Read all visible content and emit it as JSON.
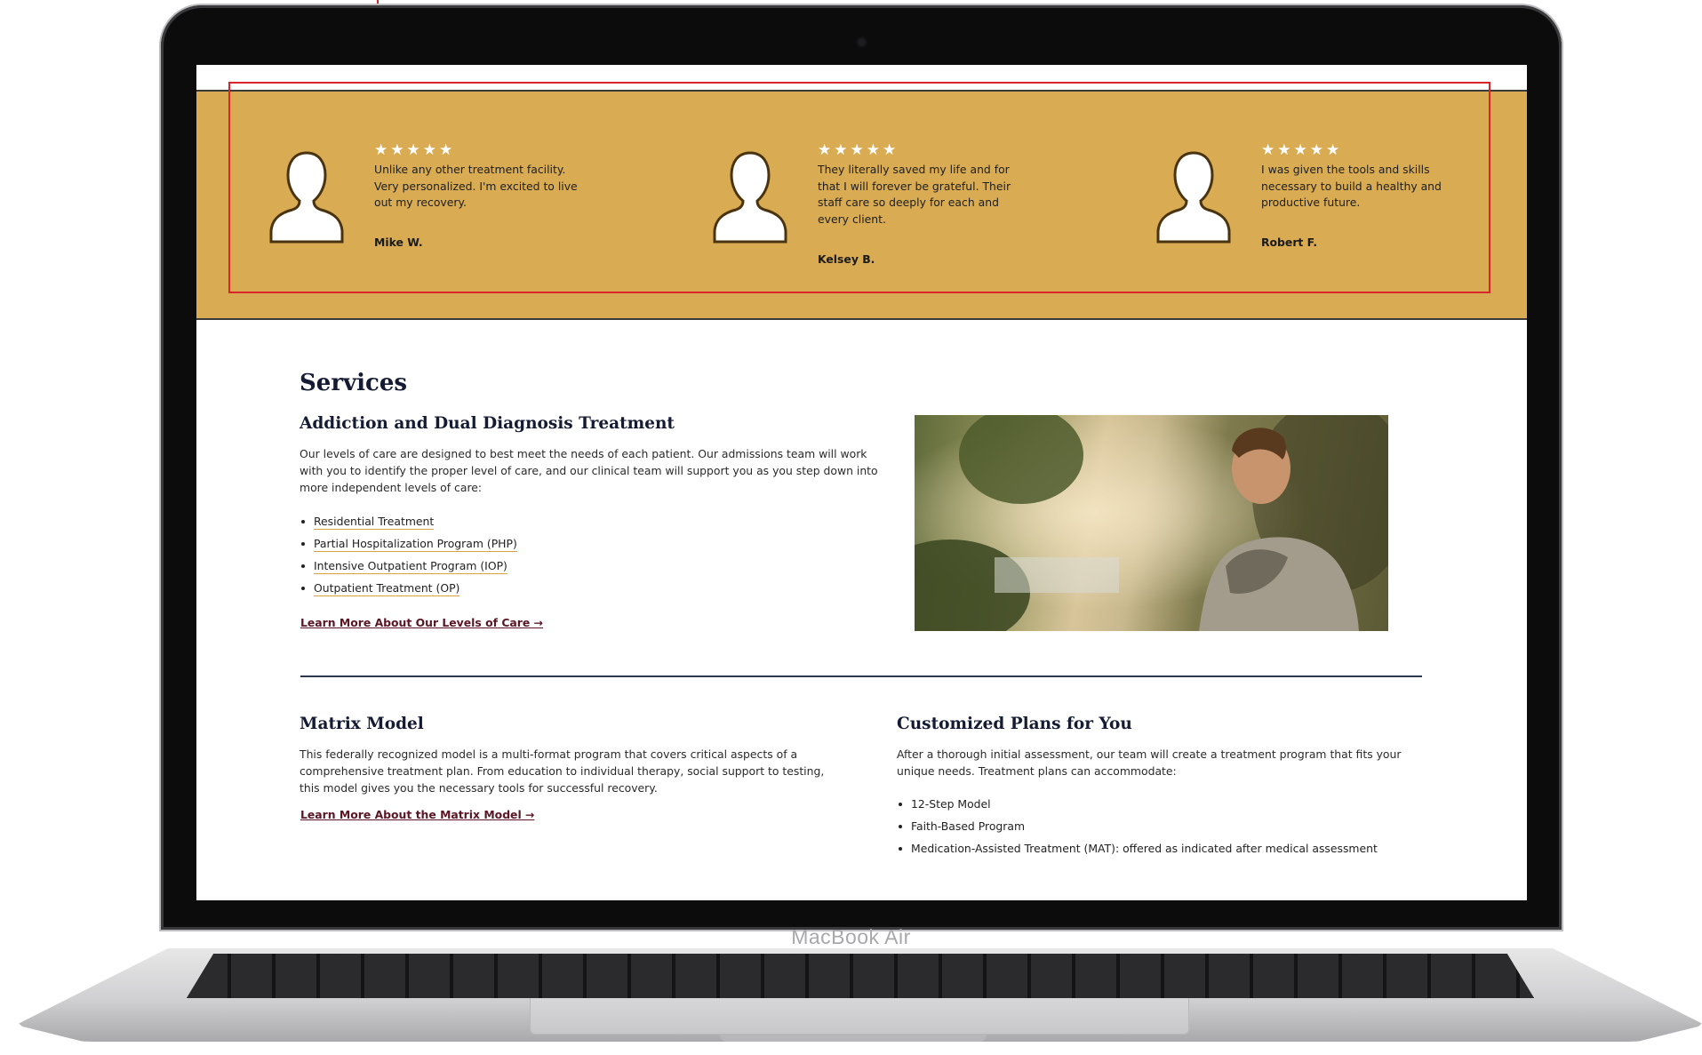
{
  "device": {
    "label": "MacBook Air"
  },
  "colors": {
    "testimonial_bg": "#d9ab52",
    "heading": "#141b33",
    "cta": "#5c1524",
    "link_underline": "#d9a33f",
    "annotation": "#d9262b"
  },
  "testimonials": [
    {
      "stars": "★★★★★",
      "rating": 5,
      "quote": "Unlike any other treatment facility. Very personalized. I'm excited to live out my recovery.",
      "author": "Mike W.",
      "avatar_icon": "user-silhouette-icon"
    },
    {
      "stars": "★★★★★",
      "rating": 5,
      "quote": "They literally saved my life and for that I will forever be grateful. Their staff care so deeply for each and every client.",
      "author": "Kelsey B.",
      "avatar_icon": "user-silhouette-icon"
    },
    {
      "stars": "★★★★★",
      "rating": 5,
      "quote": "I was given the tools and skills necessary to build a healthy and productive future.",
      "author": "Robert F.",
      "avatar_icon": "user-silhouette-icon"
    }
  ],
  "services": {
    "title": "Services",
    "addiction": {
      "heading": "Addiction and Dual Diagnosis Treatment",
      "body": "Our levels of care are designed to best meet the needs of each patient. Our admissions team will work with you to identify the proper level of care, and our clinical team will support you as you step down into more independent levels of care:",
      "items": [
        "Residential Treatment",
        "Partial Hospitalization Program (PHP)",
        "Intensive Outpatient Program (IOP)",
        "Outpatient Treatment (OP)"
      ],
      "cta": "Learn More About Our Levels of Care →"
    },
    "matrix": {
      "heading": "Matrix Model",
      "body": "This federally recognized model is a multi-format program that covers critical aspects of a comprehensive treatment plan. From education to individual therapy, social support to testing, this model gives you the necessary tools for successful recovery.",
      "cta": "Learn More About the Matrix Model →"
    },
    "custom": {
      "heading": "Customized Plans for You",
      "body": "After a thorough initial assessment, our team will create a treatment program that fits your unique needs. Treatment plans can accommodate:",
      "items": [
        "12-Step Model",
        "Faith-Based Program",
        "Medication-Assisted Treatment (MAT): offered as indicated after medical assessment"
      ]
    }
  }
}
